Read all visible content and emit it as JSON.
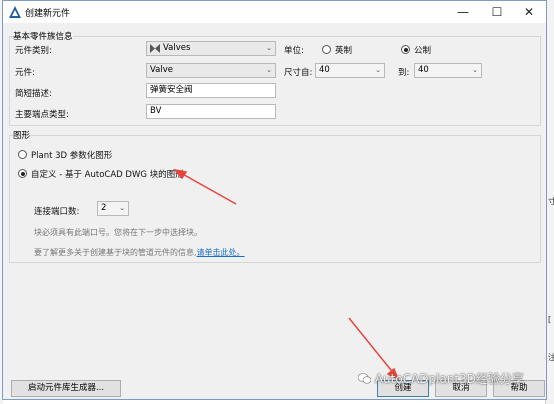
{
  "window": {
    "title": "创建新元件",
    "min": "—",
    "max": "☐",
    "close": "✕"
  },
  "background": {
    "frag_1": "寸",
    "frag_2": "[",
    "frag_3": "注"
  },
  "basic": {
    "group_title": "基本零件族信息",
    "category_label": "元件类别:",
    "category_value": "Valves",
    "component_label": "元件:",
    "component_value": "Valve",
    "short_desc_label": "简短描述:",
    "short_desc_value": "弹簧安全阀",
    "port_type_label": "主要端点类型:",
    "port_type_value": "BV",
    "units_label": "单位:",
    "unit_imperial": "英制",
    "unit_metric": "公制",
    "unit_selected": "metric",
    "size_from_label": "尺寸自:",
    "size_from_value": "40",
    "size_to_label": "到:",
    "size_to_value": "40"
  },
  "graphics": {
    "group_title": "图形",
    "option_parametric": "Plant 3D 参数化图形",
    "option_custom": "自定义 - 基于 AutoCAD DWG 块的图形",
    "selected": "custom",
    "ports_label": "连接端口数:",
    "ports_value": "2",
    "hint_1": "块必须具有此端口号。您将在下一步中选择块。",
    "hint_2_prefix": "要了解更多关于创建基于块的管道元件的信息,",
    "hint_2_link": "请单击此处。"
  },
  "footer": {
    "launch_label": "启动元件库生成器...",
    "create_label": "创建",
    "cancel_label": "取消",
    "help_label": "帮助"
  },
  "watermark": "AutoCADplant3D经验分享",
  "colors": {
    "annotation_arrow": "#e8453c",
    "accent": "#3c7fb1",
    "link": "#1a6ec7"
  }
}
